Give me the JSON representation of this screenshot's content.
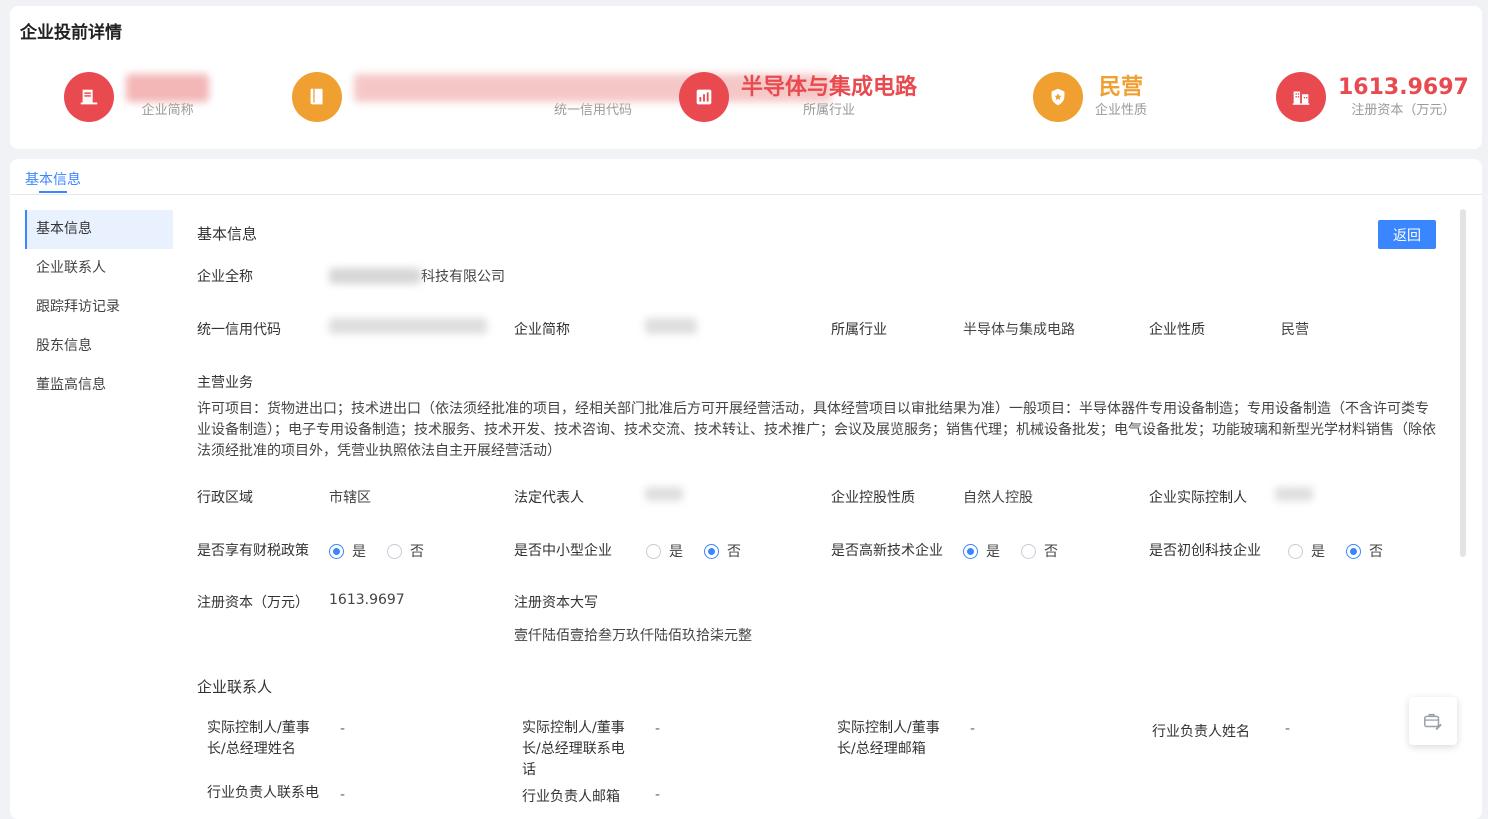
{
  "page_title": "企业投前详情",
  "stats": [
    {
      "value": "■■■■",
      "label": "企业简称",
      "icon": "book-list-icon",
      "color": "#e84a4f",
      "value_color": "#e84a4f",
      "blurred": true
    },
    {
      "value": "■■■■■■■■■■■■■■■■■■■■■■■",
      "label": "统一信用代码",
      "icon": "book-icon",
      "color": "#f0a030",
      "value_color": "#e84a4f",
      "blurred": true
    },
    {
      "value": "半导体与集成电路",
      "label": "所属行业",
      "icon": "bar-chart-icon",
      "color": "#e84a4f",
      "value_color": "#e84a4f",
      "blurred": false
    },
    {
      "value": "民营",
      "label": "企业性质",
      "icon": "shield-star-icon",
      "color": "#f0a030",
      "value_color": "#f0a030",
      "blurred": false
    },
    {
      "value": "1613.9697",
      "label": "注册资本（万元）",
      "icon": "building-icon",
      "color": "#e84a4f",
      "value_color": "#e84a4f",
      "blurred": false
    }
  ],
  "tabs": [
    "基本信息"
  ],
  "sidebar": [
    "基本信息",
    "企业联系人",
    "跟踪拜访记录",
    "股东信息",
    "董监高信息"
  ],
  "basic": {
    "title": "基本信息",
    "back_label": "返回",
    "full_name_label": "企业全称",
    "full_name_suffix": "科技有限公司",
    "row1": [
      {
        "label": "统一信用代码",
        "value": "",
        "blurred": true
      },
      {
        "label": "企业简称",
        "value": "",
        "blurred": true
      },
      {
        "label": "所属行业",
        "value": "半导体与集成电路",
        "blurred": false
      },
      {
        "label": "企业性质",
        "value": "民营",
        "blurred": false
      }
    ],
    "business_label": "主营业务",
    "business_text": "许可项目：货物进出口；技术进出口（依法须经批准的项目，经相关部门批准后方可开展经营活动，具体经营项目以审批结果为准）一般项目：半导体器件专用设备制造；专用设备制造（不含许可类专业设备制造）；电子专用设备制造；技术服务、技术开发、技术咨询、技术交流、技术转让、技术推广；会议及展览服务；销售代理；机械设备批发；电气设备批发；功能玻璃和新型光学材料销售（除依法须经批准的项目外，凭营业执照依法自主开展经营活动）",
    "row2": [
      {
        "label": "行政区域",
        "value": "市辖区",
        "blurred": false
      },
      {
        "label": "法定代表人",
        "value": "",
        "blurred": true
      },
      {
        "label": "企业控股性质",
        "value": "自然人控股",
        "blurred": false
      },
      {
        "label": "企业实际控制人",
        "value": "",
        "blurred": true
      }
    ],
    "radios": [
      {
        "label": "是否享有财税政策",
        "yes": "是",
        "no": "否",
        "selected": "yes"
      },
      {
        "label": "是否中小型企业",
        "yes": "是",
        "no": "否",
        "selected": "no"
      },
      {
        "label": "是否高新技术企业",
        "yes": "是",
        "no": "否",
        "selected": "yes"
      },
      {
        "label": "是否初创科技企业",
        "yes": "是",
        "no": "否",
        "selected": "no"
      }
    ],
    "capital_label": "注册资本（万元）",
    "capital_value": "1613.9697",
    "capital_upper_label": "注册资本大写",
    "capital_upper_value": "壹仟陆佰壹拾叁万玖仟陆佰玖拾柒元整"
  },
  "contacts": {
    "title": "企业联系人",
    "row1": [
      {
        "label": "实际控制人/董事长/总经理姓名",
        "value": "-"
      },
      {
        "label": "实际控制人/董事长/总经理联系电话",
        "value": "-"
      },
      {
        "label": "实际控制人/董事长/总经理邮箱",
        "value": "-"
      },
      {
        "label": "行业负责人姓名",
        "value": "-"
      }
    ],
    "row2": [
      {
        "label": "行业负责人联系电",
        "value": "-"
      },
      {
        "label": "行业负责人邮箱",
        "value": "-"
      }
    ]
  },
  "colors": {
    "accent": "#3a86ff",
    "red": "#e84a4f",
    "orange": "#f0a030"
  }
}
